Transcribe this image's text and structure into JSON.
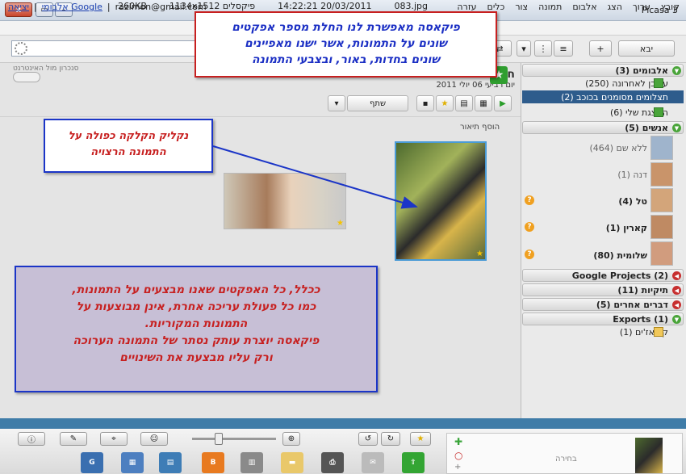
{
  "app": {
    "title": "Picasa 3",
    "close_label": "x"
  },
  "menu": [
    "קובץ",
    "ערוך",
    "הצג",
    "אלבום",
    "תמונה",
    "צור",
    "כלים",
    "עזרה"
  ],
  "user": {
    "email": "razimon@gmail.com",
    "albums_link": "אלבומי Google",
    "logout_link": "יציאה"
  },
  "toolbar": {
    "import_label": "יבא",
    "internet_sync": "סנכרון מול האינטרנט"
  },
  "album": {
    "title_initial": "ח",
    "date": "יום רביעי 06 יולי 2011",
    "share_label": "שתף",
    "description_hint": "הוסף תיאור"
  },
  "sidebar": {
    "albums": {
      "label": "אלבומים (3)",
      "items": [
        "עודכן לאחרונה (250)",
        "תצלומים מסומנים בכוכב (2)",
        "המצגת שלי (6)"
      ]
    },
    "people": {
      "label": "אנשים (5)",
      "items": [
        "ללא שם (464)",
        "דנה (1)",
        "טל (4)",
        "קארין (1)",
        "שלומית (80)"
      ]
    },
    "google_projects": "Google Projects (2)",
    "folders": "תיקיות (11)",
    "other": "דברים אחרים (5)",
    "exports": {
      "label": "Exports (1)",
      "items": [
        "קולאז'ים (1)"
      ]
    }
  },
  "status": {
    "filename": "083.jpg",
    "datetime": "14:22:21 20/03/2011",
    "dimensions": "1134x1512 פיקסלים",
    "size": "260KB"
  },
  "tray": {
    "selection_label": "בחירה"
  },
  "callouts": {
    "top": [
      "פיקאסה מאפשרת לנו החלת מספר אפקטים",
      "שונים על התמונות, אשר ישנו מאפיינים",
      "שונים בחדות, באור, ובצבעי התמונה"
    ],
    "click": [
      "נקליק הקלקה כפולה על",
      "התמונה הרצויה"
    ],
    "bottom": [
      "ככלל, כל האפקטים שאנו מבצעים על התמונות,",
      "כמו כל פעולת עריכה אחרת, אינן מבוצעות על",
      "התמונות המקוריות.",
      "פיקאסה יוצרת עותק נסתר של התמונה הערוכה",
      "ורק עליו מבצעת את השינויים"
    ]
  },
  "colors": {
    "accent": "#2e5c8c",
    "statusbar": "#3f7ca8",
    "callout_red": "#c72020",
    "callout_blue": "#1b35c7"
  }
}
